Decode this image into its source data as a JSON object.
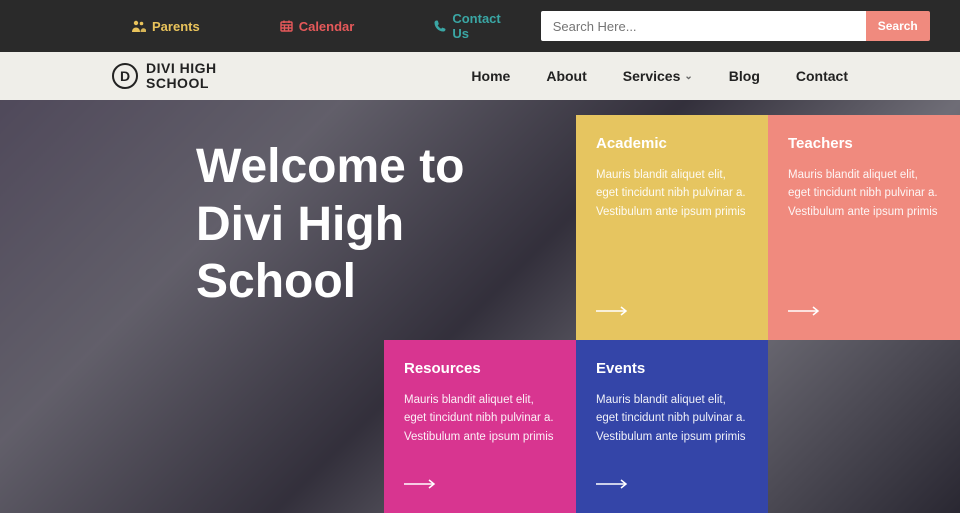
{
  "topbar": {
    "parents": "Parents",
    "calendar": "Calendar",
    "contact": "Contact Us"
  },
  "search": {
    "placeholder": "Search Here...",
    "button": "Search"
  },
  "logo": {
    "letter": "D",
    "line1": "DIVI HIGH",
    "line2": "SCHOOL"
  },
  "nav": {
    "home": "Home",
    "about": "About",
    "services": "Services",
    "blog": "Blog",
    "contact": "Contact"
  },
  "hero": {
    "title_line1": "Welcome to",
    "title_line2": "Divi High",
    "title_line3": "School"
  },
  "cards": {
    "academic": {
      "title": "Academic",
      "body": "Mauris blandit aliquet elit, eget tincidunt nibh pulvinar a. Vestibulum ante ipsum primis"
    },
    "teachers": {
      "title": "Teachers",
      "body": "Mauris blandit aliquet elit, eget tincidunt nibh pulvinar a. Vestibulum ante ipsum primis"
    },
    "resources": {
      "title": "Resources",
      "body": "Mauris blandit aliquet elit, eget tincidunt nibh pulvinar a. Vestibulum ante ipsum primis"
    },
    "events": {
      "title": "Events",
      "body": "Mauris blandit aliquet elit, eget tincidunt nibh pulvinar a. Vestibulum ante ipsum primis"
    }
  }
}
